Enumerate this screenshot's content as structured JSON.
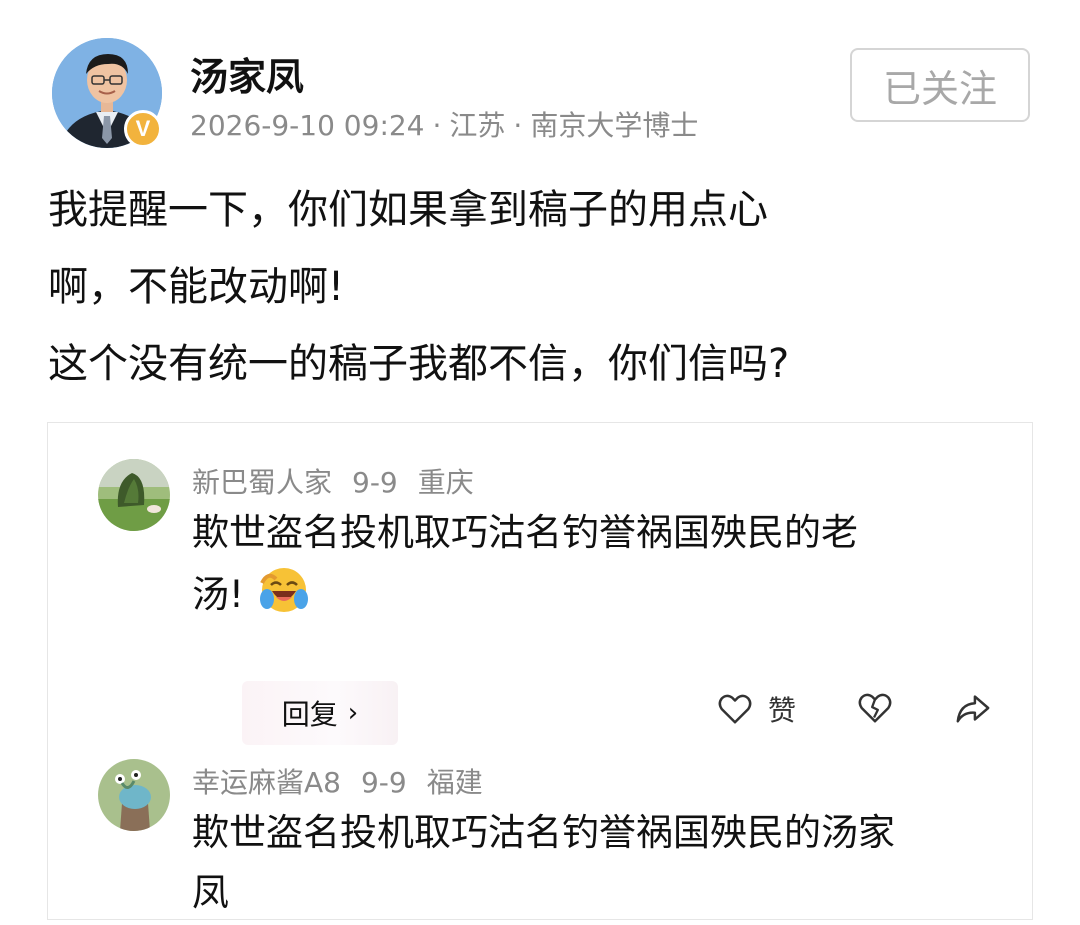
{
  "post": {
    "author": "汤家凤",
    "verified_badge": "V",
    "date": "2026-9-10 09:24",
    "separator": "·",
    "location": "江苏",
    "title": "南京大学博士",
    "follow_label": "已关注",
    "content_lines": [
      "我提醒一下，你们如果拿到稿子的用点心",
      "啊，不能改动啊!",
      "这个没有统一的稿子我都不信，你们信吗?"
    ]
  },
  "comments": [
    {
      "user": "新巴蜀人家",
      "date": "9-9",
      "location": "重庆",
      "text_lines": [
        "欺世盗名投机取巧沽名钓誉祸国殃民的老",
        "汤!"
      ],
      "emoji": "laughing-crying-emoji",
      "reply_label": "回复",
      "like_label": "赞"
    },
    {
      "user": "幸运麻酱A8",
      "date": "9-9",
      "location": "福建",
      "text_lines": [
        "欺世盗名投机取巧沽名钓誉祸国殃民的汤家",
        "凤"
      ]
    }
  ],
  "icons": {
    "like": "heart-icon",
    "dislike": "broken-heart-icon",
    "share": "share-arrow-icon",
    "reply_chevron": "chevron-right-icon"
  },
  "colors": {
    "text": "#111111",
    "meta": "#8a8a8a",
    "badge": "#f2b33d",
    "follow_border": "#d5d5d5"
  }
}
